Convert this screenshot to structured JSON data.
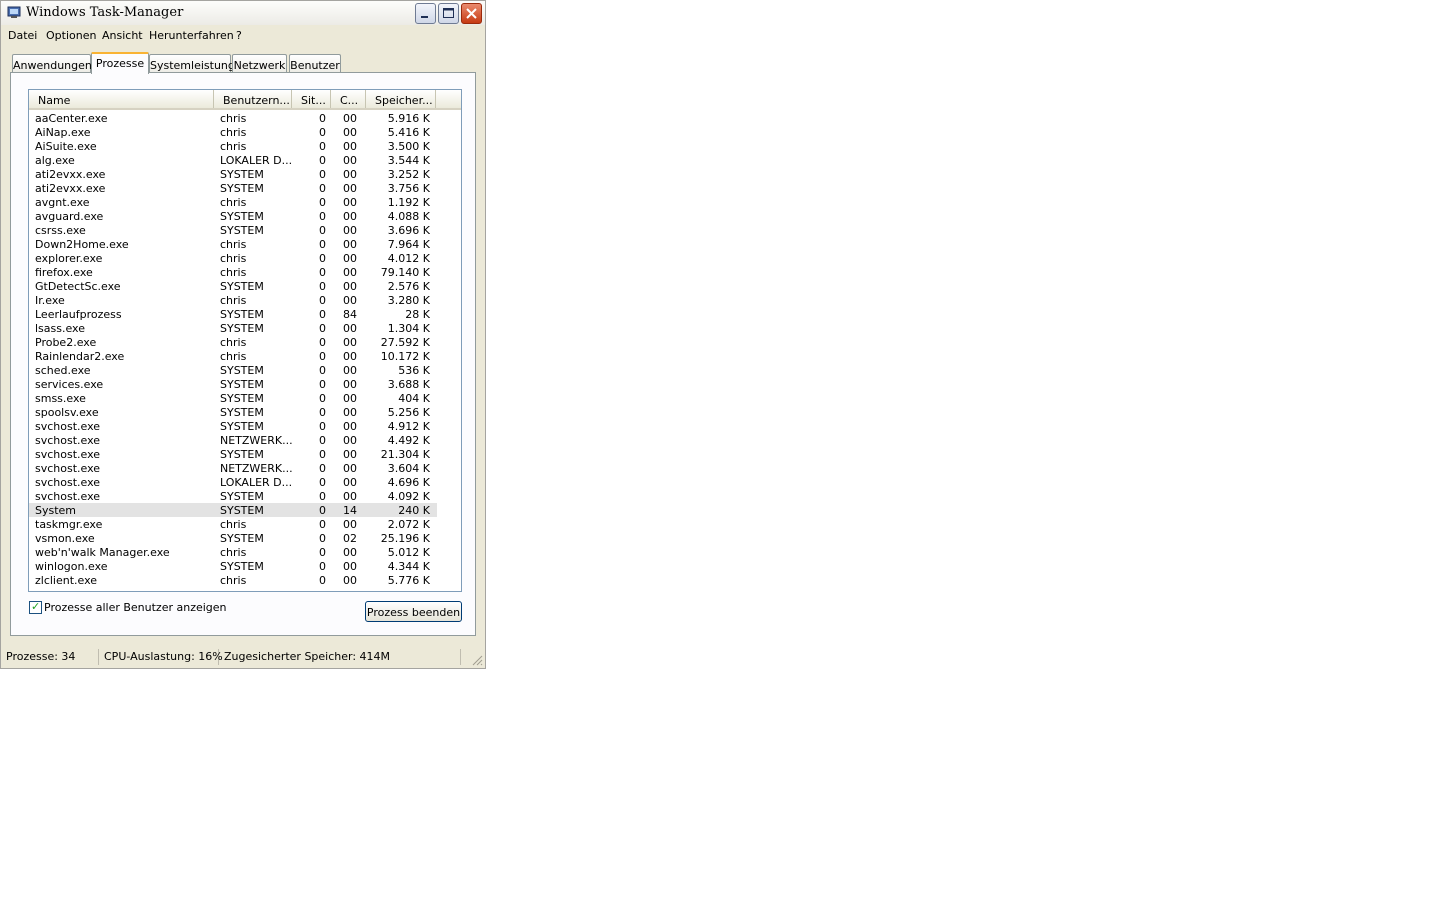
{
  "window": {
    "title": "Windows Task-Manager"
  },
  "menu": [
    "Datei",
    "Optionen",
    "Ansicht",
    "Herunterfahren",
    "?"
  ],
  "tabs": [
    "Anwendungen",
    "Prozesse",
    "Systemleistung",
    "Netzwerk",
    "Benutzer"
  ],
  "active_tab": "Prozesse",
  "columns": [
    "Name",
    "Benutzern...",
    "Sit...",
    "C...",
    "Speicher..."
  ],
  "processes": [
    [
      "aaCenter.exe",
      "chris",
      "0",
      "00",
      "5.916 K"
    ],
    [
      "AiNap.exe",
      "chris",
      "0",
      "00",
      "5.416 K"
    ],
    [
      "AiSuite.exe",
      "chris",
      "0",
      "00",
      "3.500 K"
    ],
    [
      "alg.exe",
      "LOKALER D...",
      "0",
      "00",
      "3.544 K"
    ],
    [
      "ati2evxx.exe",
      "SYSTEM",
      "0",
      "00",
      "3.252 K"
    ],
    [
      "ati2evxx.exe",
      "SYSTEM",
      "0",
      "00",
      "3.756 K"
    ],
    [
      "avgnt.exe",
      "chris",
      "0",
      "00",
      "1.192 K"
    ],
    [
      "avguard.exe",
      "SYSTEM",
      "0",
      "00",
      "4.088 K"
    ],
    [
      "csrss.exe",
      "SYSTEM",
      "0",
      "00",
      "3.696 K"
    ],
    [
      "Down2Home.exe",
      "chris",
      "0",
      "00",
      "7.964 K"
    ],
    [
      "explorer.exe",
      "chris",
      "0",
      "00",
      "4.012 K"
    ],
    [
      "firefox.exe",
      "chris",
      "0",
      "00",
      "79.140 K"
    ],
    [
      "GtDetectSc.exe",
      "SYSTEM",
      "0",
      "00",
      "2.576 K"
    ],
    [
      "Ir.exe",
      "chris",
      "0",
      "00",
      "3.280 K"
    ],
    [
      "Leerlaufprozess",
      "SYSTEM",
      "0",
      "84",
      "28 K"
    ],
    [
      "lsass.exe",
      "SYSTEM",
      "0",
      "00",
      "1.304 K"
    ],
    [
      "Probe2.exe",
      "chris",
      "0",
      "00",
      "27.592 K"
    ],
    [
      "Rainlendar2.exe",
      "chris",
      "0",
      "00",
      "10.172 K"
    ],
    [
      "sched.exe",
      "SYSTEM",
      "0",
      "00",
      "536 K"
    ],
    [
      "services.exe",
      "SYSTEM",
      "0",
      "00",
      "3.688 K"
    ],
    [
      "smss.exe",
      "SYSTEM",
      "0",
      "00",
      "404 K"
    ],
    [
      "spoolsv.exe",
      "SYSTEM",
      "0",
      "00",
      "5.256 K"
    ],
    [
      "svchost.exe",
      "SYSTEM",
      "0",
      "00",
      "4.912 K"
    ],
    [
      "svchost.exe",
      "NETZWERK...",
      "0",
      "00",
      "4.492 K"
    ],
    [
      "svchost.exe",
      "SYSTEM",
      "0",
      "00",
      "21.304 K"
    ],
    [
      "svchost.exe",
      "NETZWERK...",
      "0",
      "00",
      "3.604 K"
    ],
    [
      "svchost.exe",
      "LOKALER D...",
      "0",
      "00",
      "4.696 K"
    ],
    [
      "svchost.exe",
      "SYSTEM",
      "0",
      "00",
      "4.092 K"
    ],
    [
      "System",
      "SYSTEM",
      "0",
      "14",
      "240 K"
    ],
    [
      "taskmgr.exe",
      "chris",
      "0",
      "00",
      "2.072 K"
    ],
    [
      "vsmon.exe",
      "SYSTEM",
      "0",
      "02",
      "25.196 K"
    ],
    [
      "web'n'walk Manager.exe",
      "chris",
      "0",
      "00",
      "5.012 K"
    ],
    [
      "winlogon.exe",
      "SYSTEM",
      "0",
      "00",
      "4.344 K"
    ],
    [
      "zlclient.exe",
      "chris",
      "0",
      "00",
      "5.776 K"
    ]
  ],
  "selected_process": "System",
  "show_all_users": {
    "label": "Prozesse aller Benutzer anzeigen",
    "checked": true
  },
  "end_process_button": "Prozess beenden",
  "status": {
    "processes": "Prozesse: 34",
    "cpu": "CPU-Auslastung: 16%",
    "memory": "Zugesicherter Speicher: 414M"
  }
}
